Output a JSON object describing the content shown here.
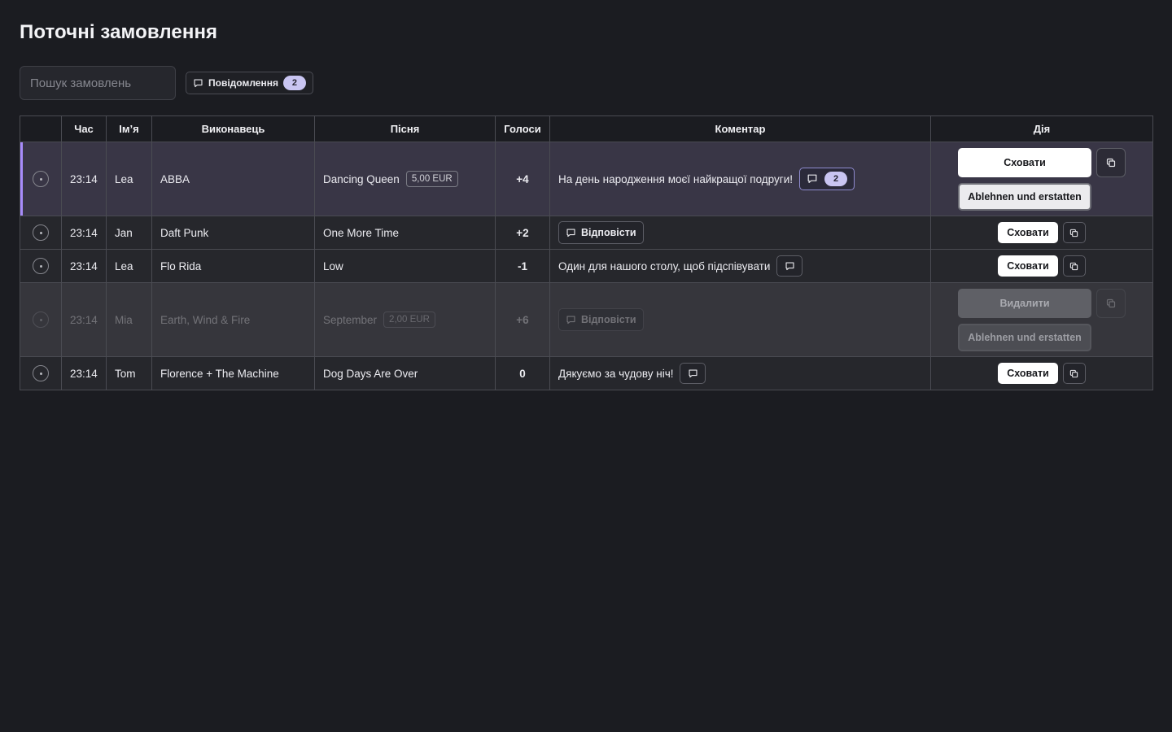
{
  "page": {
    "title": "Поточні замовлення"
  },
  "toolbar": {
    "search_placeholder": "Пошук замовлень",
    "search_value": "",
    "messages_label": "Повідомлення",
    "messages_count": "2"
  },
  "table": {
    "headers": [
      "",
      "Час",
      "Ім’я",
      "Виконавець",
      "Пісня",
      "Голоси",
      "Коментар",
      "Дія"
    ],
    "rows": [
      {
        "time": "23:14",
        "name": "Lea",
        "artist": "ABBA",
        "song": "Dancing Queen",
        "price": "5,00 EUR",
        "votes": "+4",
        "comment": "На день народження моєї найкращої подруги!",
        "comment_count": "2",
        "action_primary": "Сховати",
        "action_secondary": "Ablehnen und erstatten",
        "state": "highlighted"
      },
      {
        "time": "23:14",
        "name": "Jan",
        "artist": "Daft Punk",
        "song": "One More Time",
        "votes": "+2",
        "reply_label": "Відповісти",
        "action_primary": "Сховати",
        "state": "normal"
      },
      {
        "time": "23:14",
        "name": "Lea",
        "artist": "Flo Rida",
        "song": "Low",
        "votes": "-1",
        "comment": "Один для нашого столу, щоб підспівувати",
        "action_primary": "Сховати",
        "state": "normal"
      },
      {
        "time": "23:14",
        "name": "Mia",
        "artist": "Earth, Wind & Fire",
        "song": "September",
        "price": "2,00 EUR",
        "votes": "+6",
        "reply_label": "Відповісти",
        "action_primary": "Видалити",
        "action_secondary": "Ablehnen und erstatten",
        "state": "dimmed"
      },
      {
        "time": "23:14",
        "name": "Tom",
        "artist": "Florence + The Machine",
        "song": "Dog Days Are Over",
        "votes": "0",
        "comment": "Дякуємо за чудову ніч!",
        "action_primary": "Сховати",
        "state": "normal"
      }
    ]
  },
  "icons": {
    "status": "status-dot-icon",
    "comment": "chat-bubble-icon",
    "copy": "copy-icon"
  },
  "colors": {
    "background": "#1b1c21",
    "accent": "#a78bfa",
    "badge": "#c9c5f2"
  }
}
